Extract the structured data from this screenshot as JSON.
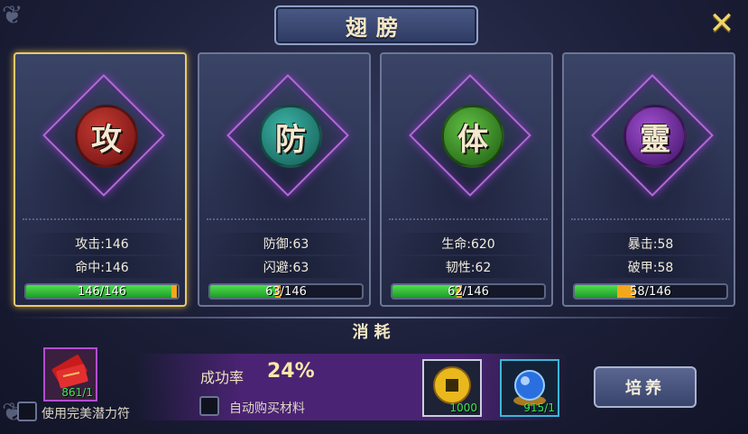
{
  "window": {
    "title": "翅膀"
  },
  "cards": [
    {
      "glyph": "攻",
      "stat1": "攻击:146",
      "stat2": "命中:146",
      "progress_text": "146/146",
      "progress": 1.0,
      "medal_color": "#8e1b1b",
      "selected": true
    },
    {
      "glyph": "防",
      "stat1": "防御:63",
      "stat2": "闪避:63",
      "progress_text": "63/146",
      "progress": 0.43,
      "medal_color": "#1f7f74",
      "selected": false
    },
    {
      "glyph": "体",
      "stat1": "生命:620",
      "stat2": "韧性:62",
      "progress_text": "62/146",
      "progress": 0.42,
      "medal_color": "#2f7a22",
      "selected": false
    },
    {
      "glyph": "靈",
      "stat1": "暴击:58",
      "stat2": "破甲:58",
      "progress_text": "58/146",
      "progress": 0.4,
      "medal_color": "#5a1f7a",
      "selected": false
    }
  ],
  "cost": {
    "title": "消耗",
    "potential_item": {
      "count": "861/1",
      "icon": "red-talisman-icon"
    },
    "use_perfect_label": "使用完美潜力符",
    "success_rate_label": "成功率",
    "success_rate_value": "24%",
    "auto_buy_label": "自动购买材料",
    "coin_item": {
      "count": "1000",
      "icon": "gold-coin-icon"
    },
    "orb_item": {
      "count": "915/1",
      "icon": "blue-orb-icon"
    },
    "cultivate_button": "培养"
  },
  "colors": {
    "accent_gold": "#e9c96b",
    "progress_green": "#3fd43f",
    "progress_tip": "#f2a81b",
    "count_green": "#3bea4e"
  }
}
